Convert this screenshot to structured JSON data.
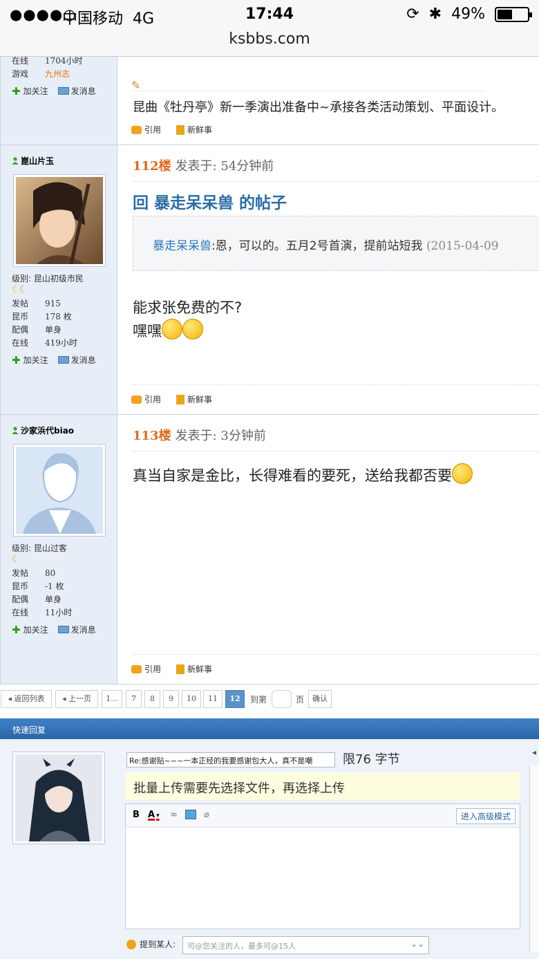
{
  "status": {
    "signal": "●●●●○",
    "carrier": "中国移动",
    "network": "4G",
    "time": "17:44",
    "battery": "49%",
    "battery_level": 0.49
  },
  "url": "ksbbs.com",
  "post_prev": {
    "stats": [
      {
        "k": "在线",
        "v": "1704小时"
      },
      {
        "k": "游戏",
        "v": "九州志"
      }
    ],
    "follow": "加关注",
    "message": "发消息",
    "signature": "昆曲《牡丹亭》新一季演出准备中~承接各类活动策划、平面设计。",
    "quote": "引用",
    "news": "新鲜事"
  },
  "post112": {
    "username": "崑山片玉",
    "level": "级别: 昆山初级市民",
    "stats": [
      {
        "k": "发帖",
        "v": "915"
      },
      {
        "k": "昆币",
        "v": "178 枚"
      },
      {
        "k": "配偶",
        "v": "单身"
      },
      {
        "k": "在线",
        "v": "419小时"
      }
    ],
    "follow": "加关注",
    "message": "发消息",
    "floor": "112楼",
    "posted": "发表于: 54分钟前",
    "title": "回 暴走呆呆兽 的帖子",
    "quote_author": "暴走呆呆兽",
    "quote_text": ":恩，可以的。五月2号首演，提前站短我",
    "quote_date": "(2015-04-09",
    "line1": "能求张免费的不?",
    "line2": "嘿嘿",
    "quote": "引用",
    "news": "新鲜事"
  },
  "post113": {
    "username": "沙家浜代biao",
    "level": "级别: 昆山过客",
    "stats": [
      {
        "k": "发帖",
        "v": "80"
      },
      {
        "k": "昆币",
        "v": "-1 枚"
      },
      {
        "k": "配偶",
        "v": "单身"
      },
      {
        "k": "在线",
        "v": "11小时"
      }
    ],
    "follow": "加关注",
    "message": "发消息",
    "floor": "113楼",
    "posted": "发表于: 3分钟前",
    "body": "真当自家是金比，长得难看的要死，送给我都否要",
    "quote": "引用",
    "news": "新鲜事"
  },
  "pager": {
    "back": "◂ 返回列表",
    "prev": "◂ 上一页",
    "pages": [
      "1...",
      "7",
      "8",
      "9",
      "10",
      "11",
      "12"
    ],
    "goto": "到第",
    "page_unit": "页",
    "confirm": "确认"
  },
  "quick_reply": {
    "title": "快速回复",
    "subject": "Re:感谢贴~~~一本正经的我要感谢包大人，真不是嘲",
    "limit": "限76 字节",
    "notice": "批量上传需要先选择文件，再选择上传",
    "tools": {
      "bold": "B",
      "color": "A"
    },
    "advanced": "进入高级模式",
    "mention_label": "提到某人:",
    "mention_placeholder": "可@您关注的人，最多可@15人"
  }
}
